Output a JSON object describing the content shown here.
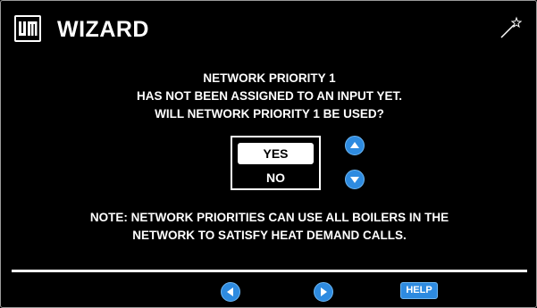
{
  "header": {
    "title": "WIZARD",
    "logo_icon": "weil-mclain-logo-icon",
    "wand_icon": "magic-wand-icon"
  },
  "message": {
    "lines": [
      "NETWORK PRIORITY 1",
      "HAS NOT BEEN ASSIGNED TO AN INPUT YET.",
      "WILL NETWORK PRIORITY 1 BE USED?"
    ]
  },
  "options": {
    "items": [
      "YES",
      "NO"
    ],
    "selected": "YES"
  },
  "note": {
    "lines": [
      "NOTE: NETWORK PRIORITIES CAN USE ALL BOILERS IN THE",
      "NETWORK TO SATISFY HEAT DEMAND CALLS."
    ]
  },
  "footer": {
    "help_label": "HELP"
  },
  "colors": {
    "background": "#000000",
    "accent": "#2e8be0",
    "text": "#ffffff"
  }
}
